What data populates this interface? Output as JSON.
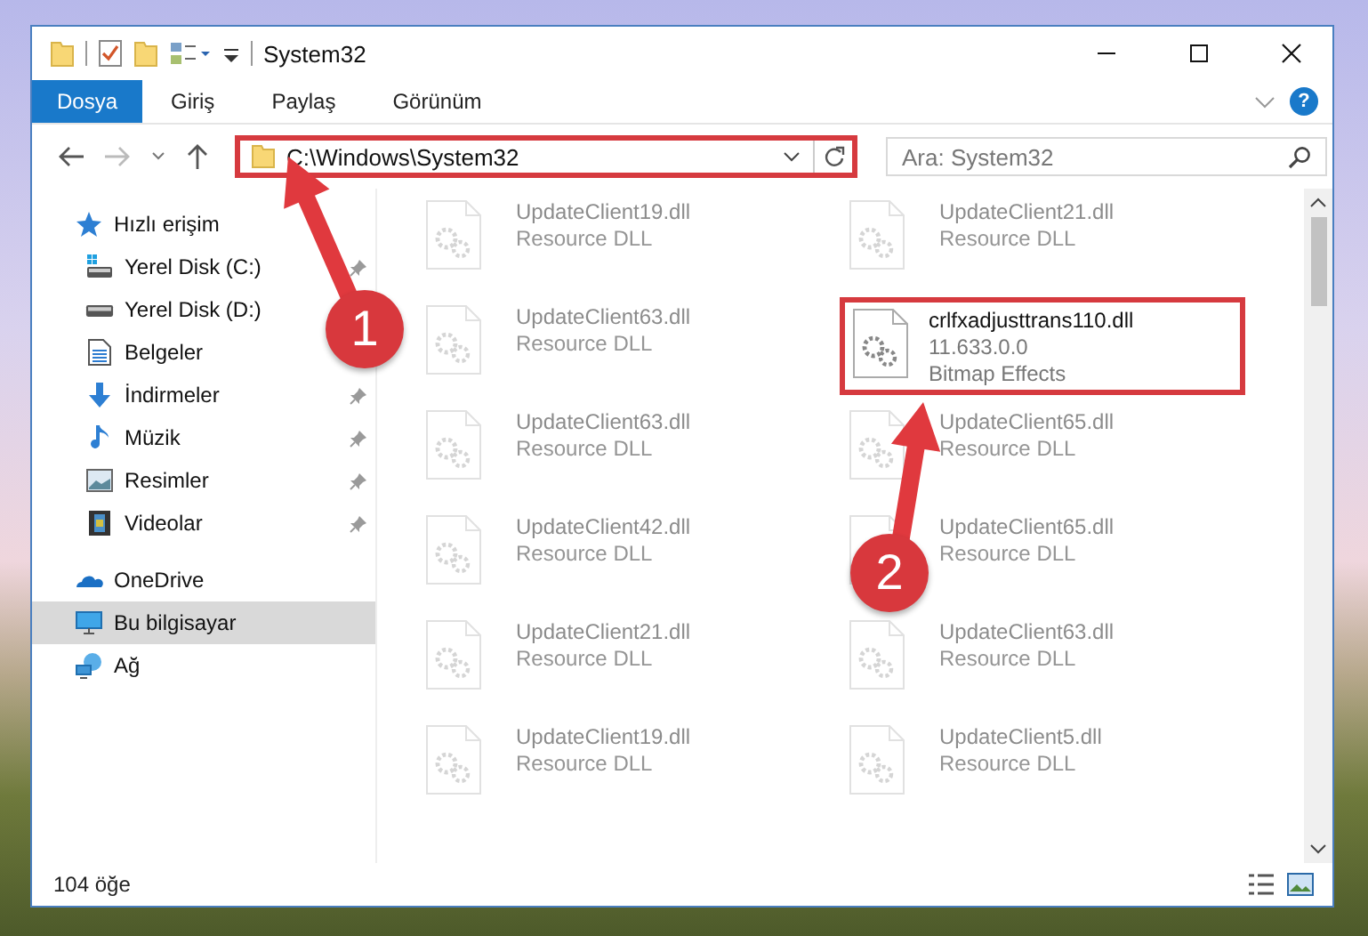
{
  "window": {
    "title": "System32"
  },
  "ribbon": {
    "tabs": [
      {
        "label": "Dosya",
        "selected": true
      },
      {
        "label": "Giriş",
        "selected": false
      },
      {
        "label": "Paylaş",
        "selected": false
      },
      {
        "label": "Görünüm",
        "selected": false
      }
    ],
    "help": "?"
  },
  "address_bar": {
    "path": "C:\\Windows\\System32",
    "highlighted": true
  },
  "search": {
    "placeholder": "Ara: System32"
  },
  "sidebar": {
    "items": [
      {
        "label": "Hızlı erişim",
        "kind": "star",
        "selected": false,
        "children": [
          {
            "label": "Yerel Disk (C:)",
            "kind": "drive-win",
            "pinned": true,
            "selected": false
          },
          {
            "label": "Yerel Disk (D:)",
            "kind": "drive",
            "pinned": false,
            "selected": false
          },
          {
            "label": "Belgeler",
            "kind": "document",
            "pinned": false,
            "selected": false
          },
          {
            "label": "İndirmeler",
            "kind": "download",
            "pinned": true,
            "selected": false
          },
          {
            "label": "Müzik",
            "kind": "music",
            "pinned": true,
            "selected": false
          },
          {
            "label": "Resimler",
            "kind": "pictures",
            "pinned": true,
            "selected": false
          },
          {
            "label": "Videolar",
            "kind": "video",
            "pinned": true,
            "selected": false
          }
        ]
      },
      {
        "label": "OneDrive",
        "kind": "cloud",
        "selected": false
      },
      {
        "label": "Bu bilgisayar",
        "kind": "computer",
        "selected": true
      },
      {
        "label": "Ağ",
        "kind": "network",
        "selected": false
      }
    ]
  },
  "files": [
    {
      "lines": [
        "UpdateClient19.dll",
        "Resource DLL"
      ],
      "highlighted": false
    },
    {
      "lines": [
        "UpdateClient21.dll",
        "Resource DLL"
      ],
      "highlighted": false
    },
    {
      "lines": [
        "UpdateClient63.dll",
        "Resource DLL"
      ],
      "highlighted": false
    },
    {
      "lines": [
        "crlfxadjusttrans110.dll",
        "11.633.0.0",
        "Bitmap Effects"
      ],
      "highlighted": true
    },
    {
      "lines": [
        "UpdateClient63.dll",
        "Resource DLL"
      ],
      "highlighted": false
    },
    {
      "lines": [
        "UpdateClient65.dll",
        "Resource DLL"
      ],
      "highlighted": false
    },
    {
      "lines": [
        "UpdateClient42.dll",
        "Resource DLL"
      ],
      "highlighted": false
    },
    {
      "lines": [
        "UpdateClient65.dll",
        "Resource DLL"
      ],
      "highlighted": false
    },
    {
      "lines": [
        "UpdateClient21.dll",
        "Resource DLL"
      ],
      "highlighted": false
    },
    {
      "lines": [
        "UpdateClient63.dll",
        "Resource DLL"
      ],
      "highlighted": false
    },
    {
      "lines": [
        "UpdateClient19.dll",
        "Resource DLL"
      ],
      "highlighted": false
    },
    {
      "lines": [
        "UpdateClient5.dll",
        "Resource DLL"
      ],
      "highlighted": false
    }
  ],
  "status_bar": {
    "count": "104 öğe"
  },
  "annotations": [
    {
      "number": "1"
    },
    {
      "number": "2"
    }
  ]
}
